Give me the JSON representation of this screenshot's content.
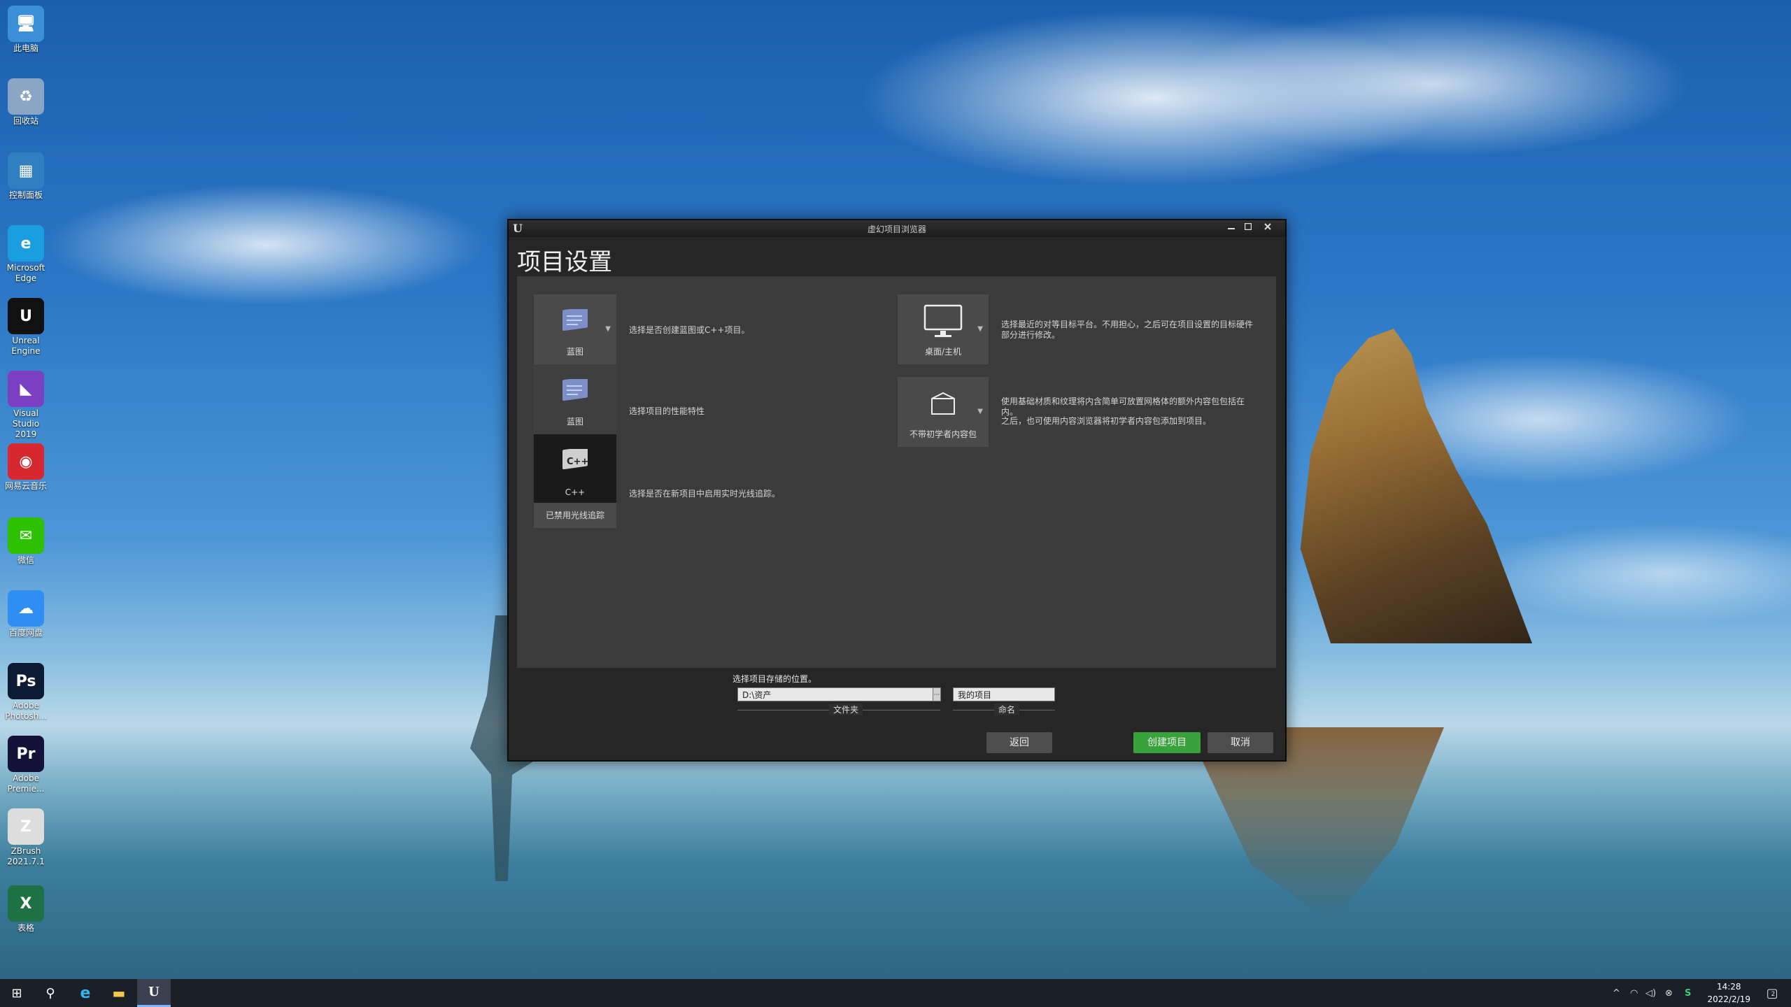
{
  "desktop": {
    "icons": [
      {
        "label": "此电脑",
        "icon": "this-pc-icon",
        "color": "#3b8fd9"
      },
      {
        "label": "回收站",
        "icon": "recycle-bin-icon",
        "color": "#8aa6c4"
      },
      {
        "label": "控制面板",
        "icon": "control-panel-icon",
        "color": "#2f7fc1"
      },
      {
        "label": "Microsoft Edge",
        "icon": "edge-icon",
        "color": "#1b9de2"
      },
      {
        "label": "Unreal Engine",
        "icon": "unreal-engine-icon",
        "color": "#111111"
      },
      {
        "label": "Visual Studio 2019",
        "icon": "visual-studio-icon",
        "color": "#7b3fc4"
      },
      {
        "label": "网易云音乐",
        "icon": "netease-music-icon",
        "color": "#d8282f"
      },
      {
        "label": "微信",
        "icon": "wechat-icon",
        "color": "#2dc100"
      },
      {
        "label": "百度网盘",
        "icon": "baidu-netdisk-icon",
        "color": "#2f8ef2"
      },
      {
        "label": "Adobe Photosh...",
        "icon": "photoshop-icon",
        "color": "#0c1a33"
      },
      {
        "label": "Adobe Premie...",
        "icon": "premiere-icon",
        "color": "#15123a"
      },
      {
        "label": "ZBrush 2021.7.1",
        "icon": "zbrush-icon",
        "color": "#dddddd"
      },
      {
        "label": "表格",
        "icon": "excel-icon",
        "color": "#1e7145"
      }
    ],
    "glyphs": [
      "🖥",
      "♻",
      "▦",
      "e",
      "U",
      "◣",
      "◉",
      "✉",
      "☁",
      "Ps",
      "Pr",
      "Z",
      "X"
    ]
  },
  "dialog": {
    "window_title": "虚幻项目浏览器",
    "logo_glyph": "U",
    "page_title": "项目设置",
    "tiles": {
      "blueprint_top": "蓝图",
      "blueprint": "蓝图",
      "cpp": "C++",
      "raytracing": "已禁用光线追踪",
      "desktop": "桌面/主机",
      "starter": "不带初学者内容包"
    },
    "descriptions": {
      "blueprint_cpp": "选择是否创建蓝图或C++项目。",
      "performance": "选择项目的性能特性",
      "raytracing": "选择是否在新项目中启用实时光线追踪。",
      "platform": "选择最近的对等目标平台。不用担心，之后可在项目设置的目标硬件部分进行修改。",
      "starter_line1": "使用基础材质和纹理将内含简单可放置网格体的额外内容包包括在内。",
      "starter_line2": "之后，也可使用内容浏览器将初学者内容包添加到项目。"
    },
    "storage_label": "选择项目存储的位置。",
    "folder_value": "D:\\资产",
    "folder_browse": "···",
    "folder_caption": "文件夹",
    "name_value": "我的项目",
    "name_caption": "命名",
    "buttons": {
      "back": "返回",
      "create": "创建项目",
      "cancel": "取消"
    },
    "colors": {
      "create_button": "#3aa23a",
      "button": "#555555"
    }
  },
  "taskbar": {
    "time": "14:28",
    "date": "2022/2/19",
    "notification_count": "2",
    "start_glyph": "⊞",
    "search_glyph": "⚲",
    "edge_glyph": "e",
    "explorer_glyph": "▬",
    "unreal_glyph": "U",
    "tray_glyphs": {
      "chevron": "^",
      "network": "◠",
      "volume": "◁)",
      "ime": "⊗",
      "sync": "S",
      "notification": "▢"
    }
  }
}
